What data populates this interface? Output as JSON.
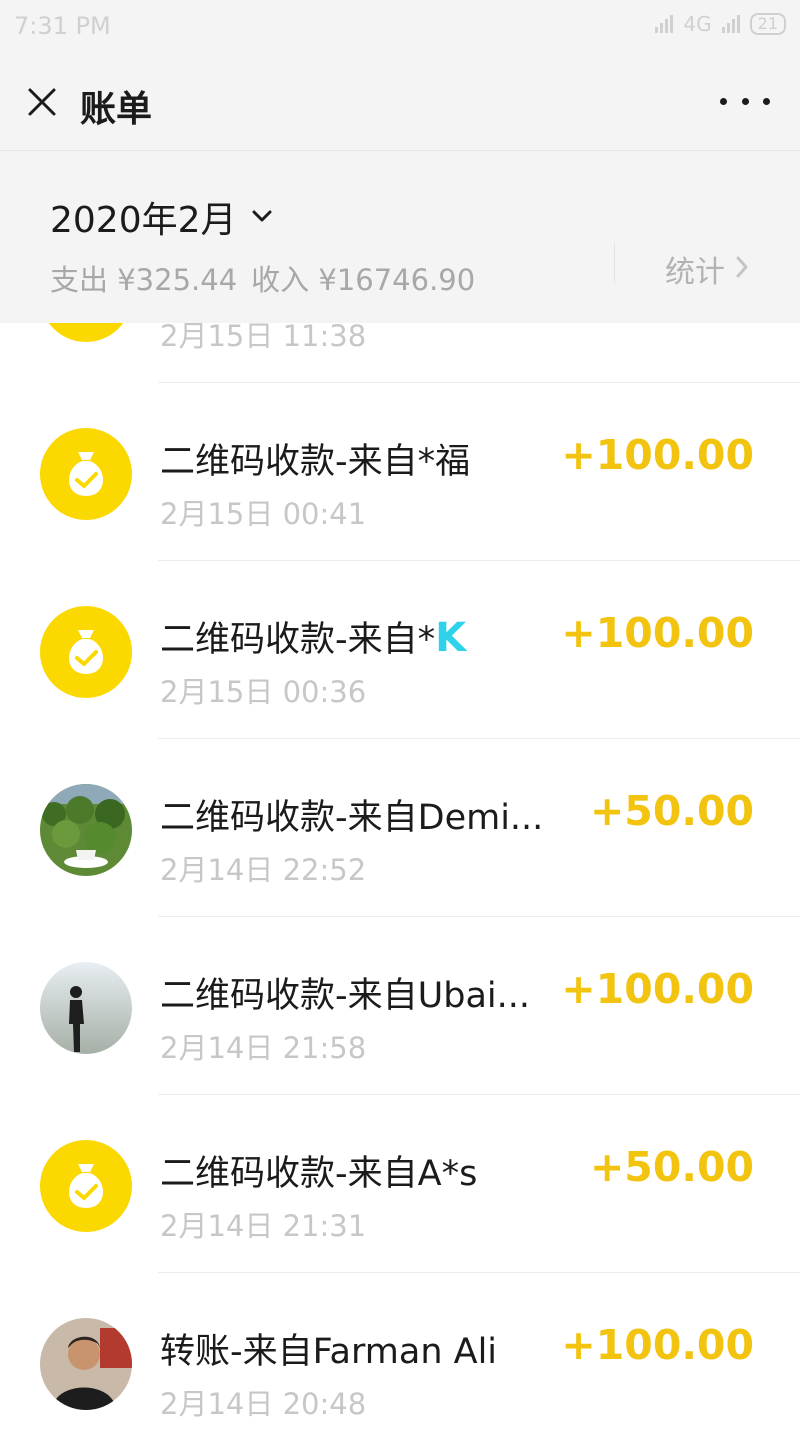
{
  "status_bar": {
    "time": "7:31 PM",
    "network": "4G",
    "battery": "21"
  },
  "nav": {
    "title": "账单",
    "close_icon": "close-icon",
    "more_icon": "more-icon"
  },
  "header": {
    "month": "2020年2月",
    "expense_label": "支出 ¥325.44",
    "income_label": "收入 ¥16746.90",
    "stats_label": "统计"
  },
  "transactions": [
    {
      "title": "",
      "time": "2月15日 11:38",
      "amount": "",
      "avatar": "moneybag-icon"
    },
    {
      "title": "二维码收款-来自*福",
      "time": "2月15日 00:41",
      "amount": "+100.00",
      "avatar": "moneybag-icon"
    },
    {
      "title": "二维码收款-来自*",
      "title_suffix": "K",
      "time": "2月15日 00:36",
      "amount": "+100.00",
      "avatar": "moneybag-icon"
    },
    {
      "title": "二维码收款-来自Demi...",
      "time": "2月14日 22:52",
      "amount": "+50.00",
      "avatar": "forest-photo"
    },
    {
      "title": "二维码收款-来自Ubai...",
      "time": "2月14日 21:58",
      "amount": "+100.00",
      "avatar": "person-photo"
    },
    {
      "title": "二维码收款-来自A*s",
      "time": "2月14日 21:31",
      "amount": "+50.00",
      "avatar": "moneybag-icon"
    },
    {
      "title": "转账-来自Farman Ali",
      "time": "2月14日 20:48",
      "amount": "+100.00",
      "avatar": "person-photo"
    }
  ],
  "colors": {
    "accent": "#f2c40f",
    "avatar_yellow": "#fbd800",
    "k_glyph": "#2ed3ea"
  }
}
